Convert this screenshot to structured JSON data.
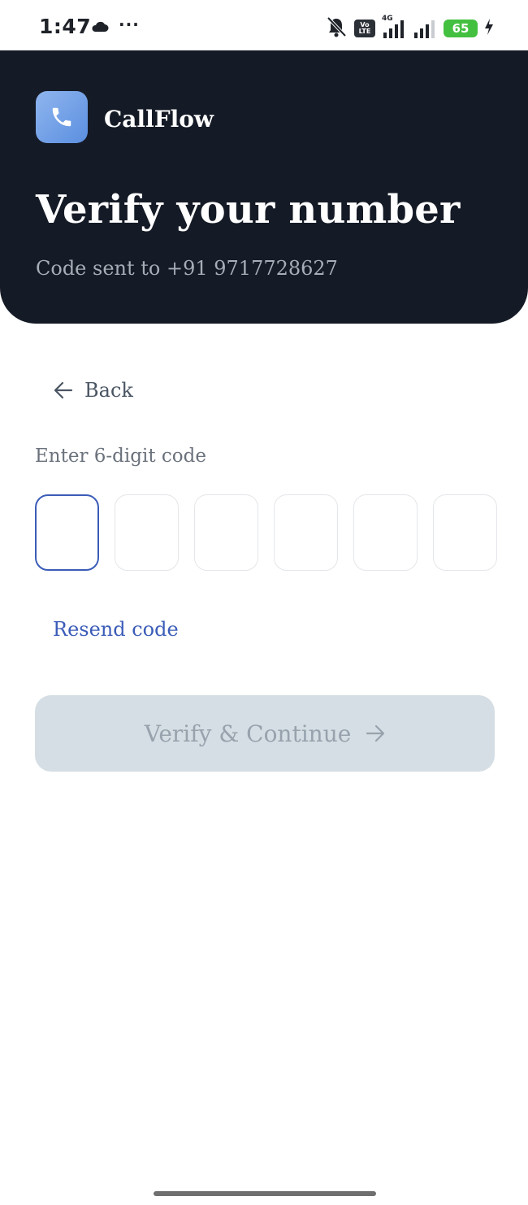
{
  "status_bar": {
    "time": "1:47",
    "more": "···",
    "network_label": "4G",
    "volte_line1": "Vo",
    "volte_line2": "LTE",
    "battery_level": "65",
    "icons": [
      "cloud-icon",
      "silent-bell-icon",
      "signal-icon",
      "battery-icon",
      "charging-icon"
    ]
  },
  "header": {
    "app_name": "CallFlow",
    "title": "Verify your number",
    "subtitle": "Code sent to +91 9717728627",
    "background_color": "#151b26",
    "logo_icon": "phone-icon"
  },
  "back": {
    "label": "Back",
    "icon": "arrow-left-icon"
  },
  "code_entry": {
    "label": "Enter 6-digit code",
    "digits": [
      "",
      "",
      "",
      "",
      "",
      ""
    ],
    "active_index": 0,
    "accent_color": "#3b5cb8"
  },
  "resend": {
    "label": "Resend code"
  },
  "verify_button": {
    "label": "Verify & Continue",
    "icon": "arrow-right-icon",
    "disabled": true
  }
}
